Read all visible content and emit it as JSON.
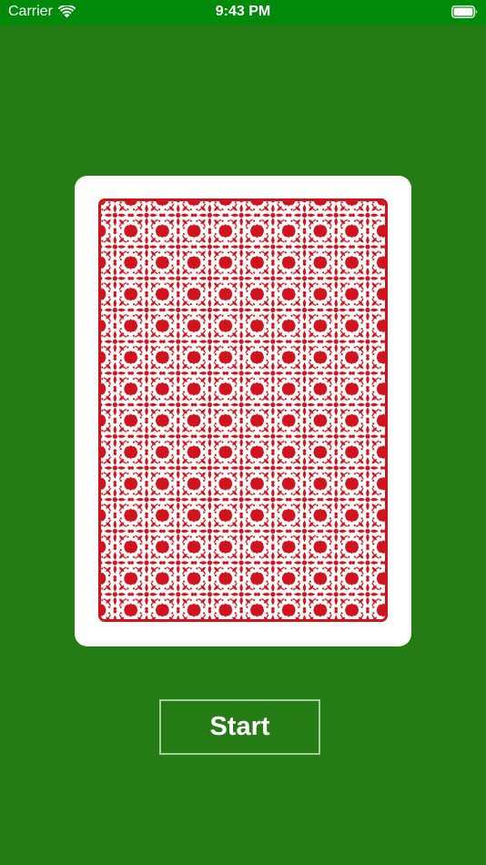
{
  "status_bar": {
    "carrier": "Carrier",
    "time": "9:43 PM",
    "icons": [
      "wifi-icon",
      "battery-icon"
    ]
  },
  "card": {
    "face": "card-back",
    "pattern_color": "#d0141e"
  },
  "start_button": {
    "label": "Start"
  },
  "colors": {
    "table_green": "#267c14",
    "status_bar_green": "#008a0a",
    "button_border": "#a6cf9c",
    "card_white": "#ffffff"
  }
}
